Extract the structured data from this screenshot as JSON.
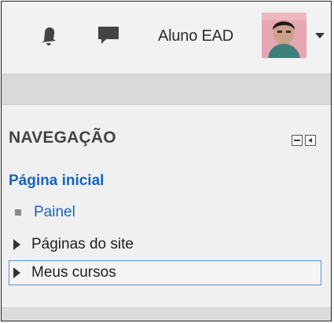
{
  "navbar": {
    "notification_icon": "bell-icon",
    "messages_icon": "speech-bubble-icon",
    "user_name": "Aluno EAD",
    "user_menu_icon": "caret-down-icon"
  },
  "navigation_block": {
    "title": "NAVEGAÇÃO",
    "controls": [
      "minimize-icon",
      "dock-icon"
    ],
    "home_link": "Página inicial",
    "items": [
      {
        "label": "Painel",
        "kind": "link",
        "marker": "square-bullet"
      },
      {
        "label": "Páginas do site",
        "kind": "expandable",
        "marker": "triangle-right"
      },
      {
        "label": "Meus cursos",
        "kind": "expandable",
        "marker": "triangle-right",
        "focused": true
      }
    ]
  },
  "colors": {
    "link": "#1565c0",
    "focus_border": "#5b8fd6",
    "block_bg": "#f0f0f0"
  }
}
